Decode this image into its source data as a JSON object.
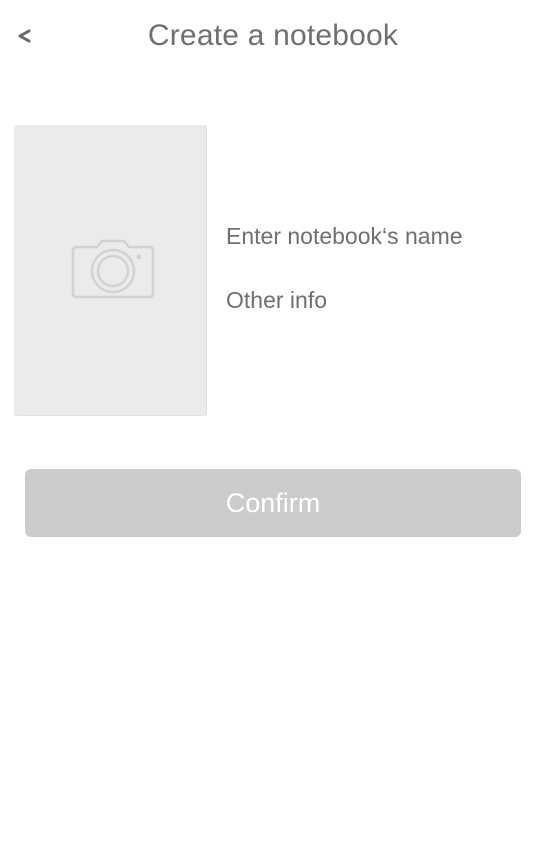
{
  "header": {
    "back_icon": "chevron-left-icon",
    "title": "Create a notebook"
  },
  "cover": {
    "icon": "camera-icon",
    "background_color": "#ebebeb"
  },
  "form": {
    "name_placeholder": "Enter notebook‘s name",
    "name_value": "",
    "info_placeholder": "Other info",
    "info_value": ""
  },
  "confirm": {
    "label": "Confirm",
    "background_color": "#cccccc",
    "text_color": "#ffffff"
  }
}
